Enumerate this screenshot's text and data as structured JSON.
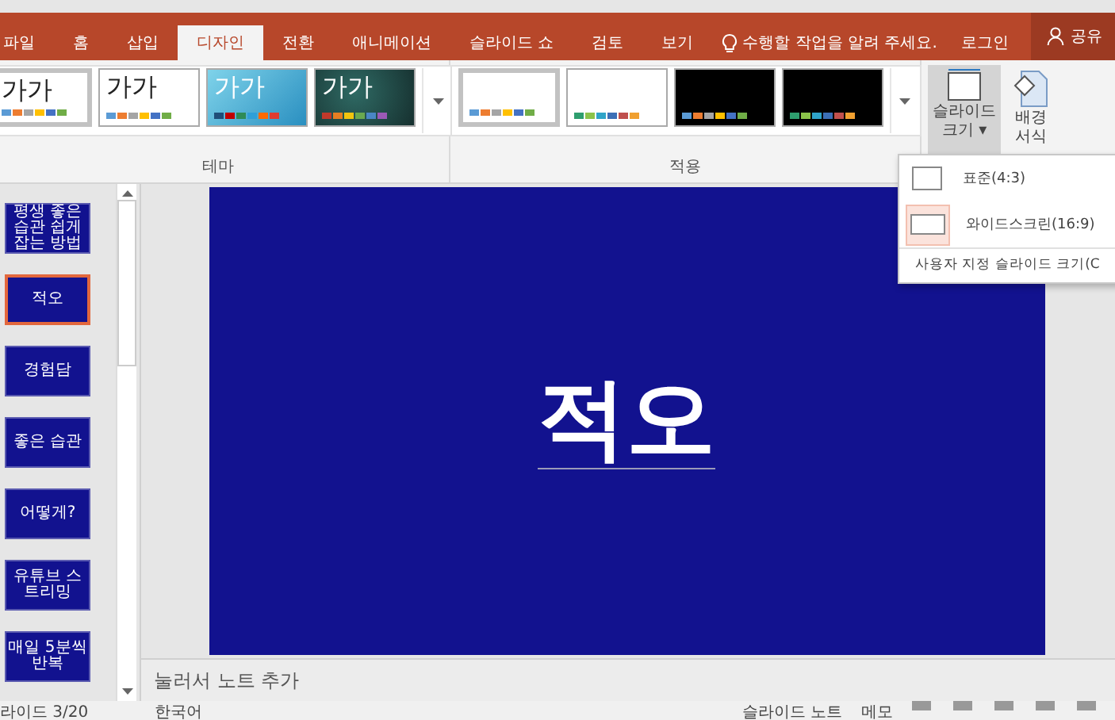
{
  "tabs": [
    {
      "label": "파일",
      "selected": false
    },
    {
      "label": "홈",
      "selected": false
    },
    {
      "label": "삽입",
      "selected": false
    },
    {
      "label": "디자인",
      "selected": true
    },
    {
      "label": "전환",
      "selected": false
    },
    {
      "label": "애니메이션",
      "selected": false
    },
    {
      "label": "슬라이드 쇼",
      "selected": false
    },
    {
      "label": "검토",
      "selected": false
    },
    {
      "label": "보기",
      "selected": false
    }
  ],
  "tell_me": "수행할 작업을 알려 주세요.",
  "login": "로그인",
  "share": "공유",
  "themes": {
    "items": [
      {
        "label": "가가",
        "kind": "plain",
        "selected": true
      },
      {
        "label": "가가",
        "kind": "plain",
        "selected": false
      },
      {
        "label": "가가",
        "kind": "blue",
        "selected": false
      },
      {
        "label": "가가",
        "kind": "teal",
        "selected": false
      }
    ],
    "group_label": "테마"
  },
  "variants": {
    "items": [
      {
        "kind": "white",
        "selected": true
      },
      {
        "kind": "white",
        "selected": false
      },
      {
        "kind": "black",
        "selected": false
      },
      {
        "kind": "black",
        "selected": false
      }
    ],
    "group_label": "적용"
  },
  "slide_size_button": {
    "lines": [
      "슬라이드",
      "크기 ▾"
    ]
  },
  "background_button": {
    "lines": [
      "배경",
      "서식"
    ]
  },
  "size_menu": {
    "items": [
      {
        "label": "표준(4:3)",
        "selected": false
      },
      {
        "label": "와이드스크린(16:9)",
        "selected": true
      }
    ],
    "custom": "사용자 지정 슬라이드 크기(C"
  },
  "thumbnails": [
    {
      "text": "평생 좋은 습관 쉽게 잡는 방법",
      "selected": false
    },
    {
      "text": "적오",
      "selected": true
    },
    {
      "text": "경험담",
      "selected": false
    },
    {
      "text": "좋은 습관",
      "selected": false
    },
    {
      "text": "어떻게?",
      "selected": false
    },
    {
      "text": "유튜브 스트리밍",
      "selected": false
    },
    {
      "text": "매일 5분씩 반복",
      "selected": false
    }
  ],
  "slide_title": "적오",
  "notes_placeholder": "눌러서 노트 추가",
  "status_bar": {
    "slide_count": "라이드 3/20",
    "language": "한국어",
    "notes": "슬라이드 노트",
    "comments": "메모"
  }
}
